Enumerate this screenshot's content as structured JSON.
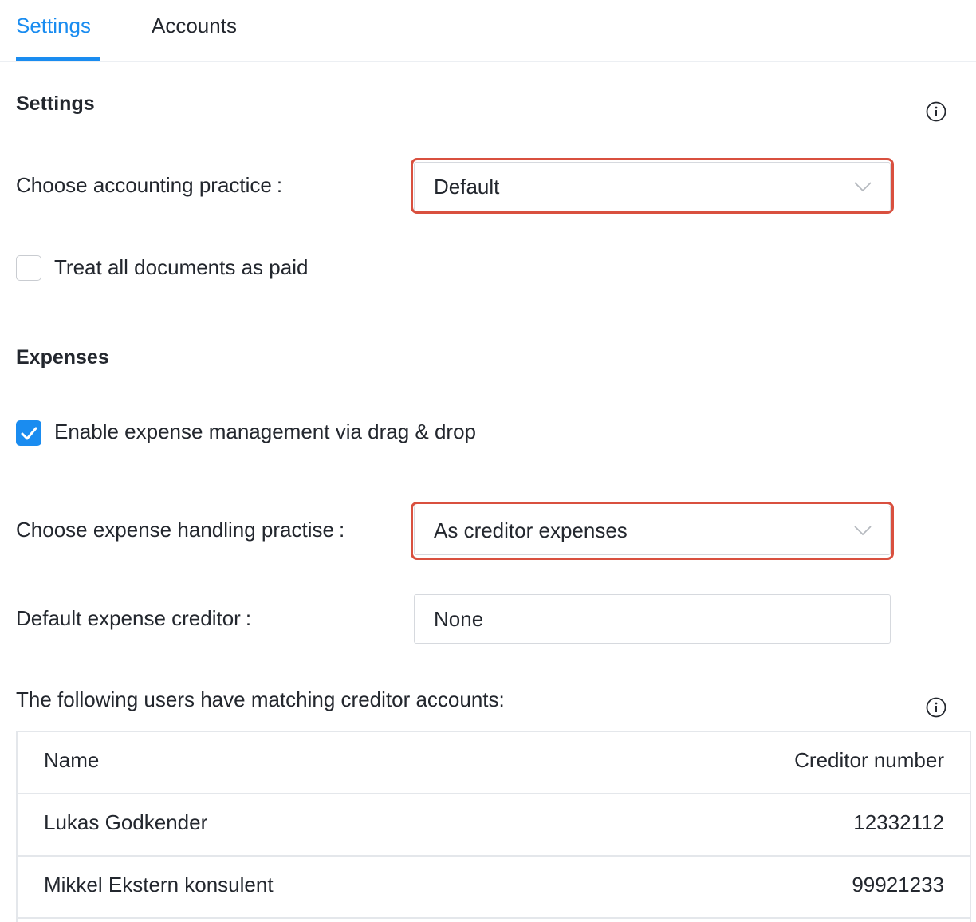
{
  "tabs": [
    {
      "label": "Settings",
      "active": true
    },
    {
      "label": "Accounts",
      "active": false
    }
  ],
  "settings_section": {
    "title": "Settings",
    "accounting_practice_label": "Choose accounting practice",
    "accounting_practice_value": "Default",
    "treat_paid_label": "Treat all documents as paid",
    "treat_paid_checked": false
  },
  "expenses_section": {
    "title": "Expenses",
    "enable_drag_drop_label": "Enable expense management via drag & drop",
    "enable_drag_drop_checked": true,
    "handling_practise_label": "Choose expense handling practise",
    "handling_practise_value": "As creditor expenses",
    "default_creditor_label": "Default expense creditor",
    "default_creditor_value": "None",
    "matching_users_text": "The following users have matching creditor accounts:"
  },
  "creditor_table": {
    "columns": [
      "Name",
      "Creditor number"
    ],
    "rows": [
      {
        "name": "Lukas Godkender",
        "number": "12332112"
      },
      {
        "name": "Mikkel Ekstern konsulent",
        "number": "99921233"
      }
    ]
  },
  "colors": {
    "accent": "#1a8cf0",
    "highlight": "#d9503f",
    "border": "#d6d9de",
    "text": "#23272e"
  },
  "icons": [
    "info-icon",
    "chevron-down-icon",
    "checkmark-icon"
  ]
}
